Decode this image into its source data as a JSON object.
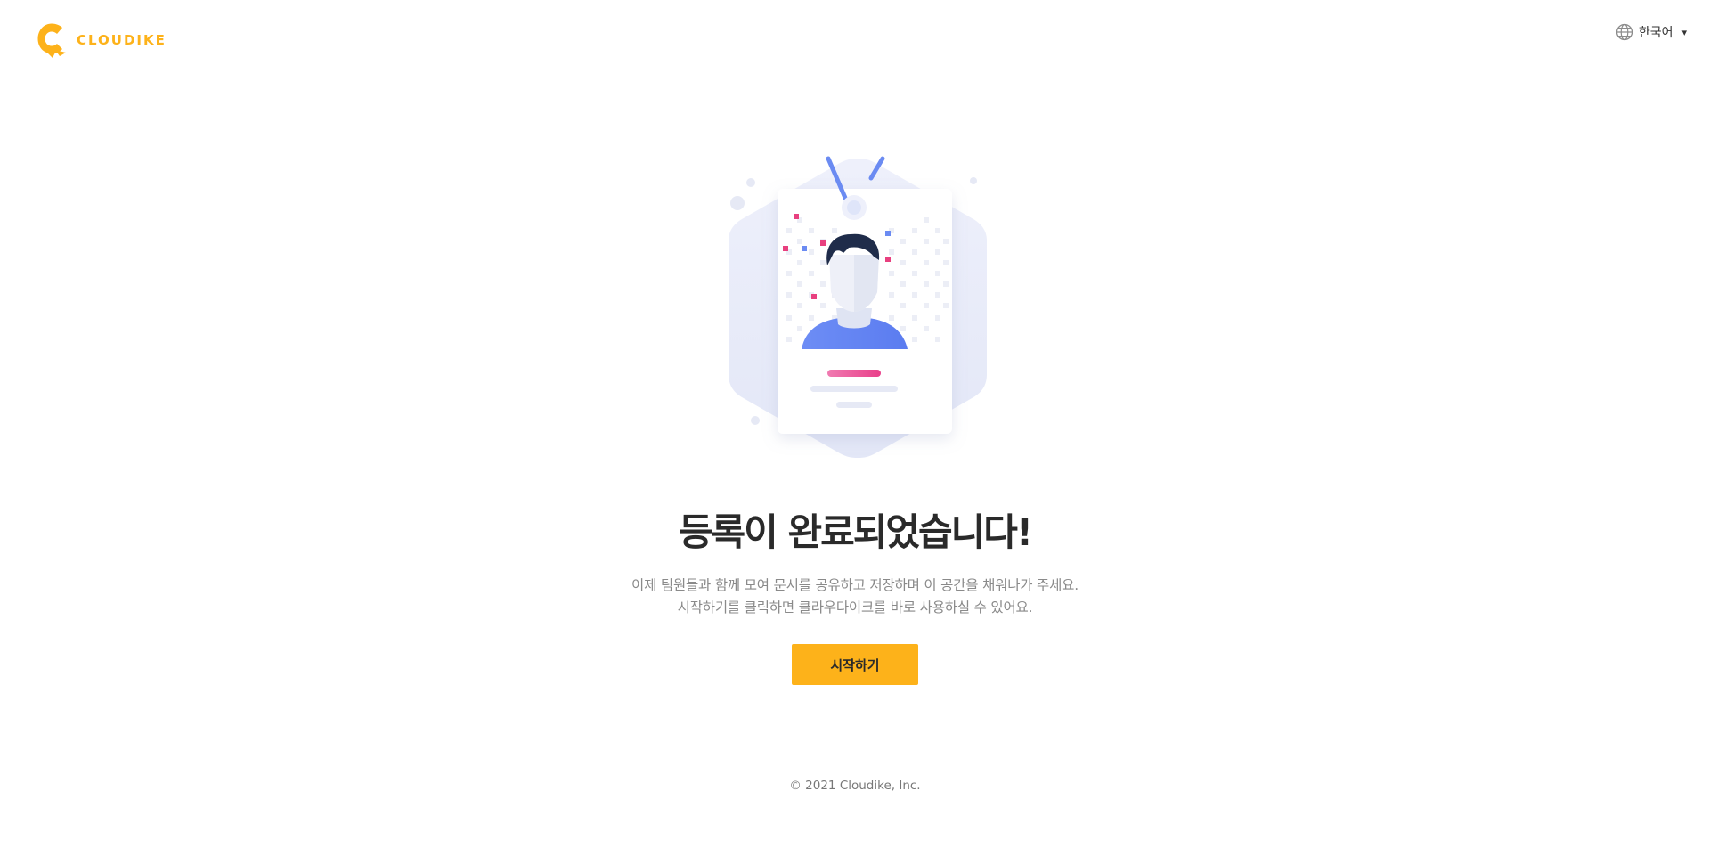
{
  "brand": {
    "logo_text": "CLOUDIKE",
    "color": "#FDB21A"
  },
  "language": {
    "icon": "globe-icon",
    "selected": "한국어"
  },
  "main": {
    "title": "등록이 완료되었습니다!",
    "description_line1": "이제 팀원들과 함께 모여 문서를 공유하고 저장하며 이 공간을 채워나가 주세요.",
    "description_line2": "시작하기를 클릭하면 클라우다이크를 바로 사용하실 수 있어요.",
    "start_button": "시작하기"
  },
  "footer": {
    "copyright": "© 2021 Cloudike, Inc."
  }
}
